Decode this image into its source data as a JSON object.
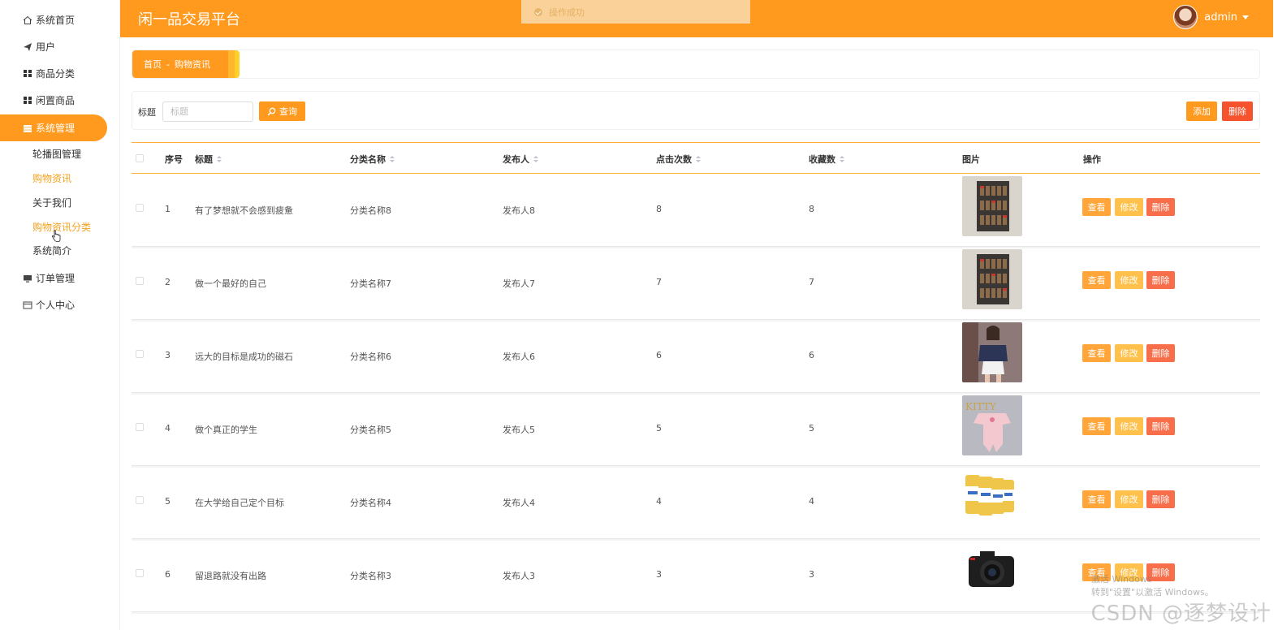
{
  "header": {
    "brand": "闲一品交易平台",
    "toast": "操作成功",
    "user_name": "admin"
  },
  "sidebar": {
    "items": [
      {
        "label": "系统首页",
        "icon": "home-icon"
      },
      {
        "label": "用户",
        "icon": "paper-plane-icon"
      },
      {
        "label": "商品分类",
        "icon": "grid-icon"
      },
      {
        "label": "闲置商品",
        "icon": "grid-icon"
      },
      {
        "label": "系统管理",
        "icon": "table-icon"
      },
      {
        "label": "订单管理",
        "icon": "monitor-icon"
      },
      {
        "label": "个人中心",
        "icon": "card-icon"
      }
    ],
    "sub_items": [
      "轮播图管理",
      "购物资讯",
      "关于我们",
      "购物资讯分类",
      "系统简介"
    ]
  },
  "breadcrumb": {
    "home": "首页",
    "separator": "-",
    "current": "购物资讯"
  },
  "search": {
    "label": "标题",
    "placeholder": "标题",
    "query_label": "查询",
    "add_label": "添加",
    "delete_label": "删除"
  },
  "table": {
    "headers": {
      "index": "序号",
      "title": "标题",
      "category": "分类名称",
      "publisher": "发布人",
      "clicks": "点击次数",
      "favorites": "收藏数",
      "image": "图片",
      "actions": "操作"
    },
    "actions": {
      "view": "查看",
      "edit": "修改",
      "delete": "删除"
    },
    "rows": [
      {
        "index": "1",
        "title": "有了梦想就不会感到疲惫",
        "category": "分类名称8",
        "publisher": "发布人8",
        "clicks": "8",
        "favorites": "8",
        "image": "spice-rack"
      },
      {
        "index": "2",
        "title": "做一个最好的自己",
        "category": "分类名称7",
        "publisher": "发布人7",
        "clicks": "7",
        "favorites": "7",
        "image": "spice-rack"
      },
      {
        "index": "3",
        "title": "远大的目标是成功的磁石",
        "category": "分类名称6",
        "publisher": "发布人6",
        "clicks": "6",
        "favorites": "6",
        "image": "off-shoulder-top"
      },
      {
        "index": "4",
        "title": "做个真正的学生",
        "category": "分类名称5",
        "publisher": "发布人5",
        "clicks": "5",
        "favorites": "5",
        "image": "baby-clothes"
      },
      {
        "index": "5",
        "title": "在大学给自己定个目标",
        "category": "分类名称4",
        "publisher": "发布人4",
        "clicks": "4",
        "favorites": "4",
        "image": "milk-powder-cans"
      },
      {
        "index": "6",
        "title": "留退路就没有出路",
        "category": "分类名称3",
        "publisher": "发布人3",
        "clicks": "3",
        "favorites": "3",
        "image": "camera"
      }
    ]
  },
  "overlay": {
    "watermark": "CSDN @逐梦设计",
    "activate_line1": "激活 Windows",
    "activate_line2": "转到\"设置\"以激活 Windows。"
  }
}
